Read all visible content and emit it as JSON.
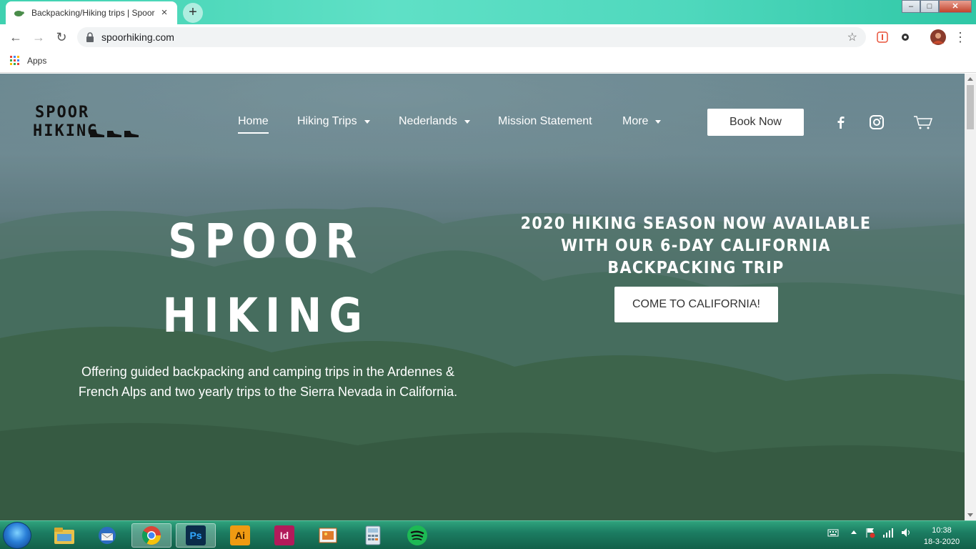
{
  "browser": {
    "tab_title": "Backpacking/Hiking trips | Spoor",
    "tab_close": "×",
    "new_tab": "+",
    "url": "spoorhiking.com",
    "bookmarks_apps": "Apps",
    "window_controls": {
      "minimize": "–",
      "maximize": "□",
      "close": "✕"
    }
  },
  "site": {
    "logo_line1": "SPOOR",
    "logo_line2": "HIKING",
    "nav": {
      "home": "Home",
      "hiking_trips": "Hiking Trips",
      "nederlands": "Nederlands",
      "mission": "Mission Statement",
      "more": "More"
    },
    "book_now": "Book Now",
    "hero": {
      "title_line1": "SPOOR",
      "title_line2": "HIKING",
      "subtitle": "Offering guided backpacking and camping trips in the Ardennes & French Alps and two yearly trips to the Sierra Nevada in California.",
      "season_announcement": "2020 HIKING SEASON NOW AVAILABLE WITH OUR 6-DAY CALIFORNIA BACKPACKING TRIP",
      "cta": "COME TO CALIFORNIA!"
    }
  },
  "taskbar": {
    "apps": [
      "file-explorer",
      "thunderbird",
      "chrome",
      "photoshop",
      "illustrator",
      "indesign",
      "photo-viewer",
      "calculator",
      "spotify"
    ],
    "labels": {
      "photoshop": "Ps",
      "illustrator": "Ai",
      "indesign": "Id"
    },
    "time": "10:38",
    "date": "18-3-2020"
  },
  "colors": {
    "titlebar": "#4fd8bd",
    "taskbar": "#1c7d62",
    "cta_bg": "#ffffff",
    "hero_text": "#ffffff"
  }
}
